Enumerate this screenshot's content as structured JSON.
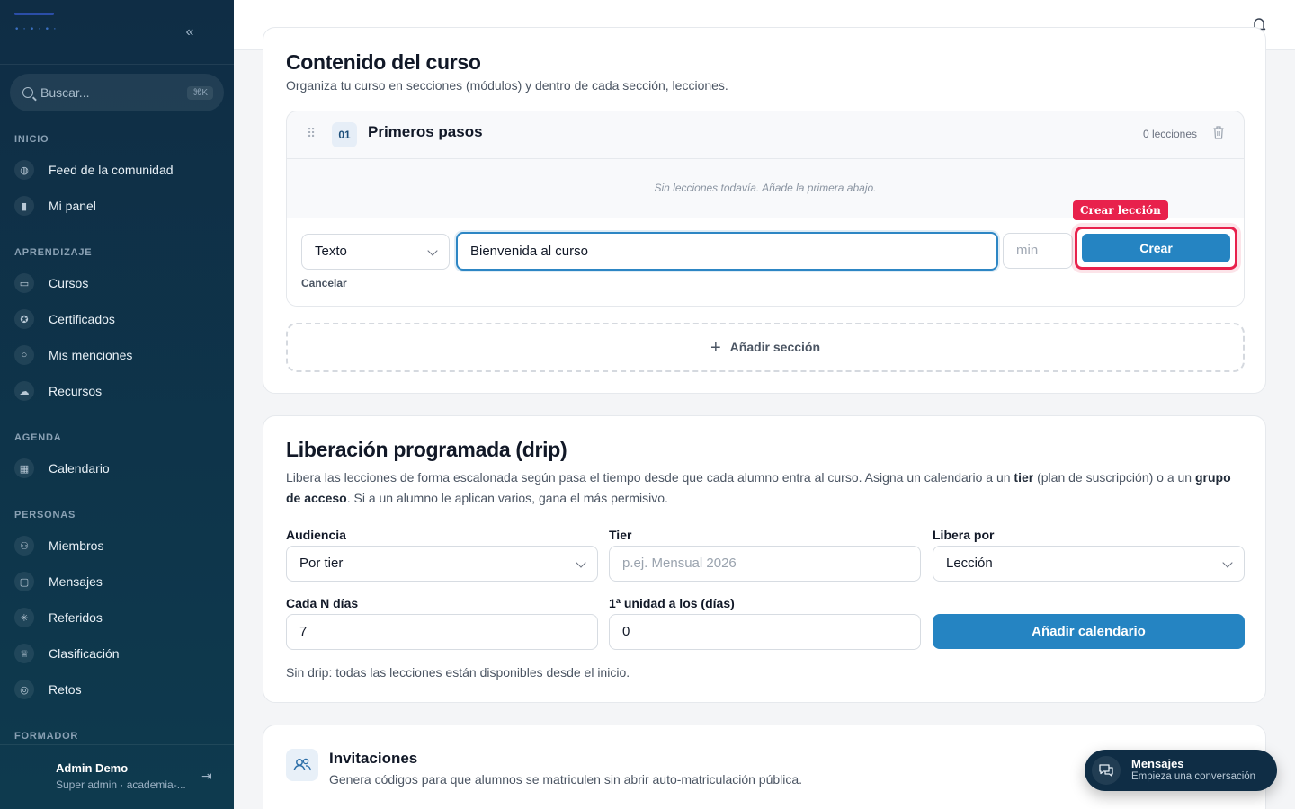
{
  "sidebar": {
    "search_placeholder": "Buscar...",
    "search_shortcut": "⌘K",
    "sections": {
      "inicio": "INICIO",
      "aprendizaje": "APRENDIZAJE",
      "agenda": "AGENDA",
      "personas": "PERSONAS",
      "formador": "FORMADOR"
    },
    "items": {
      "feed": "Feed de la comunidad",
      "panel": "Mi panel",
      "cursos": "Cursos",
      "certificados": "Certificados",
      "menciones": "Mis menciones",
      "recursos": "Recursos",
      "calendario": "Calendario",
      "miembros": "Miembros",
      "mensajes": "Mensajes",
      "referidos": "Referidos",
      "clasificacion": "Clasificación",
      "retos": "Retos"
    },
    "user": {
      "name": "Admin Demo",
      "role": "Super admin · academia-..."
    }
  },
  "content": {
    "title": "Contenido del curso",
    "subtitle": "Organiza tu curso en secciones (módulos) y dentro de cada sección, lecciones.",
    "module": {
      "number": "01",
      "title": "Primeros pasos",
      "count": "0 lecciones",
      "empty": "Sin lecciones todavía. Añade la primera abajo."
    },
    "lesson_form": {
      "type": "Texto",
      "title_value": "Bienvenida al curso",
      "minutes_placeholder": "min",
      "create_label": "Crear",
      "cancel_label": "Cancelar",
      "highlight_tag": "Crear lección"
    },
    "add_section": "Añadir sección"
  },
  "drip": {
    "title": "Liberación programada (drip)",
    "desc_1": "Libera las lecciones de forma escalonada según pasa el tiempo desde que cada alumno entra al curso. Asigna un calendario a un ",
    "desc_tier": "tier",
    "desc_2": " (plan de suscripción) o a un ",
    "desc_group": "grupo de acceso",
    "desc_3": ". Si a un alumno le aplican varios, gana el más permisivo.",
    "audience_label": "Audiencia",
    "audience_value": "Por tier",
    "tier_label": "Tier",
    "tier_placeholder": "p.ej. Mensual 2026",
    "release_label": "Libera por",
    "release_value": "Lección",
    "every_label": "Cada N días",
    "every_value": "7",
    "first_label": "1ª unidad a los (días)",
    "first_value": "0",
    "add_button": "Añadir calendario",
    "note": "Sin drip: todas las lecciones están disponibles desde el inicio."
  },
  "invitations": {
    "title": "Invitaciones",
    "subtitle": "Genera códigos para que alumnos se matriculen sin abrir auto-matriculación pública."
  },
  "messages_widget": {
    "title": "Mensajes",
    "subtitle": "Empieza una conversación"
  },
  "colors": {
    "accent": "#2584c2",
    "sidebar": "#0f2d45",
    "highlight": "#e8214c"
  }
}
